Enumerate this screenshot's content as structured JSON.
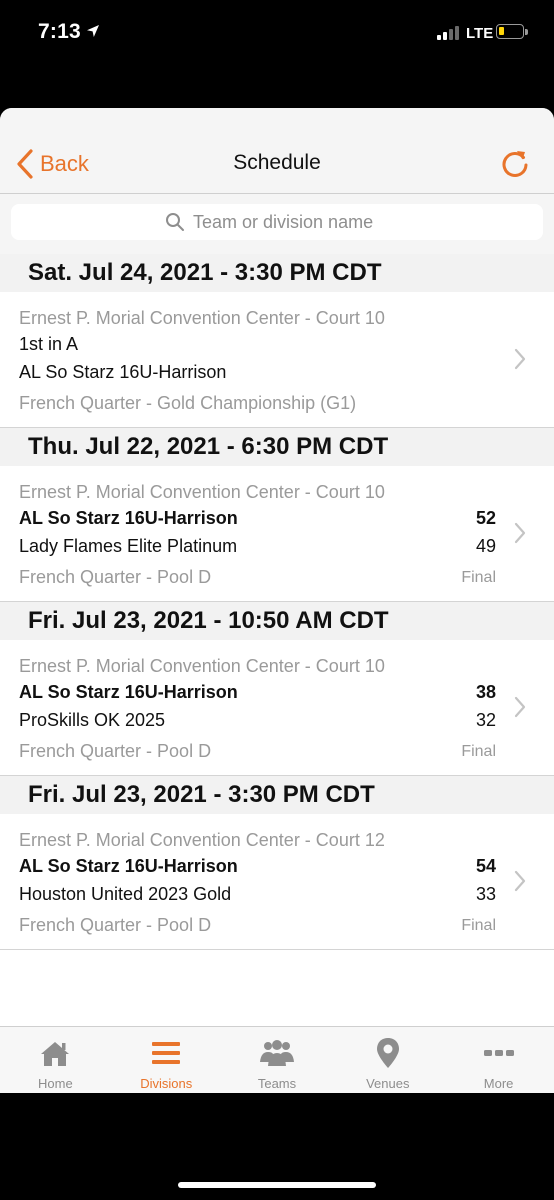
{
  "status_bar": {
    "time": "7:13",
    "network": "LTE"
  },
  "header": {
    "back_label": "Back",
    "title": "Schedule"
  },
  "search": {
    "placeholder": "Team or division name"
  },
  "sections": [
    {
      "date": "Sat. Jul 24, 2021 - 3:30 PM CDT",
      "games": [
        {
          "venue": "Ernest P. Morial Convention Center - Court 10",
          "team1": "1st in A",
          "team2": "AL So Starz 16U-Harrison",
          "score1": "",
          "score2": "",
          "division": "French Quarter - Gold Championship (G1)",
          "status": ""
        }
      ]
    },
    {
      "date": "Thu. Jul 22, 2021 - 6:30 PM CDT",
      "games": [
        {
          "venue": "Ernest P. Morial Convention Center - Court 10",
          "team1": "AL So Starz 16U-Harrison",
          "team2": "Lady Flames Elite Platinum",
          "score1": "52",
          "score2": "49",
          "division": "French Quarter - Pool D",
          "status": "Final"
        }
      ]
    },
    {
      "date": "Fri. Jul 23, 2021 - 10:50 AM CDT",
      "games": [
        {
          "venue": "Ernest P. Morial Convention Center - Court 10",
          "team1": "AL So Starz 16U-Harrison",
          "team2": "ProSkills OK 2025",
          "score1": "38",
          "score2": "32",
          "division": "French Quarter - Pool D",
          "status": "Final"
        }
      ]
    },
    {
      "date": "Fri. Jul 23, 2021 - 3:30 PM CDT",
      "games": [
        {
          "venue": "Ernest P. Morial Convention Center - Court 12",
          "team1": "AL So Starz 16U-Harrison",
          "team2": "Houston United 2023 Gold",
          "score1": "54",
          "score2": "33",
          "division": "French Quarter - Pool D",
          "status": "Final"
        }
      ]
    }
  ],
  "tabs": [
    {
      "label": "Home",
      "icon": "home-icon",
      "active": false
    },
    {
      "label": "Divisions",
      "icon": "divisions-icon",
      "active": true
    },
    {
      "label": "Teams",
      "icon": "teams-icon",
      "active": false
    },
    {
      "label": "Venues",
      "icon": "venues-icon",
      "active": false
    },
    {
      "label": "More",
      "icon": "more-icon",
      "active": false
    }
  ],
  "colors": {
    "accent": "#e8742b",
    "inactive": "#8d8d8d"
  }
}
